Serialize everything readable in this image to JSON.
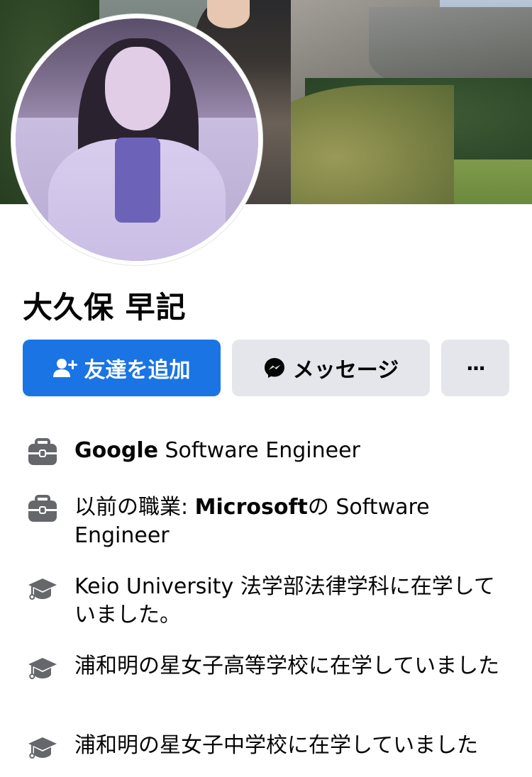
{
  "profile": {
    "name": "大久保 早記"
  },
  "actions": {
    "add_friend_label": "友達を追加",
    "message_label": "メッセージ",
    "more_label": "···"
  },
  "intro": {
    "items": [
      {
        "icon": "briefcase-icon",
        "prefix": "",
        "bold": "Google",
        "text": " Software Engineer"
      },
      {
        "icon": "briefcase-icon",
        "prefix": "以前の職業: ",
        "bold": "Microsoft",
        "text": "の Software Engineer"
      },
      {
        "icon": "graduation-cap-icon",
        "prefix": "",
        "bold": "",
        "text": "Keio University 法学部法律学科に在学していました。"
      },
      {
        "icon": "graduation-cap-icon",
        "prefix": "",
        "bold": "",
        "text": "浦和明の星女子高等学校に在学していました"
      },
      {
        "icon": "graduation-cap-icon",
        "prefix": "",
        "bold": "",
        "text": "浦和明の星女子中学校に在学していました"
      }
    ]
  },
  "colors": {
    "primary": "#1b74e4",
    "secondary_button": "#e4e6eb",
    "icon_gray": "#65676b",
    "text": "#050505"
  }
}
